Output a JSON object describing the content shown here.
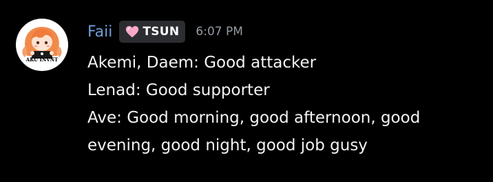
{
  "message": {
    "author": {
      "name": "Faii",
      "name_color": "#6f9fd8",
      "avatar_caption": "AKU INVNT",
      "tag": {
        "icon": "pink-heart-icon",
        "label": "TSUN"
      }
    },
    "timestamp": "6:07 PM",
    "lines": [
      "Akemi, Daem: Good attacker",
      "Lenad: Good supporter",
      "Ave: Good morning, good afternoon, good evening, good night, good job gusy"
    ]
  },
  "colors": {
    "background": "#000000",
    "text": "#f2f3f5",
    "muted": "#949ba4",
    "tag_background": "#2b2d31"
  }
}
